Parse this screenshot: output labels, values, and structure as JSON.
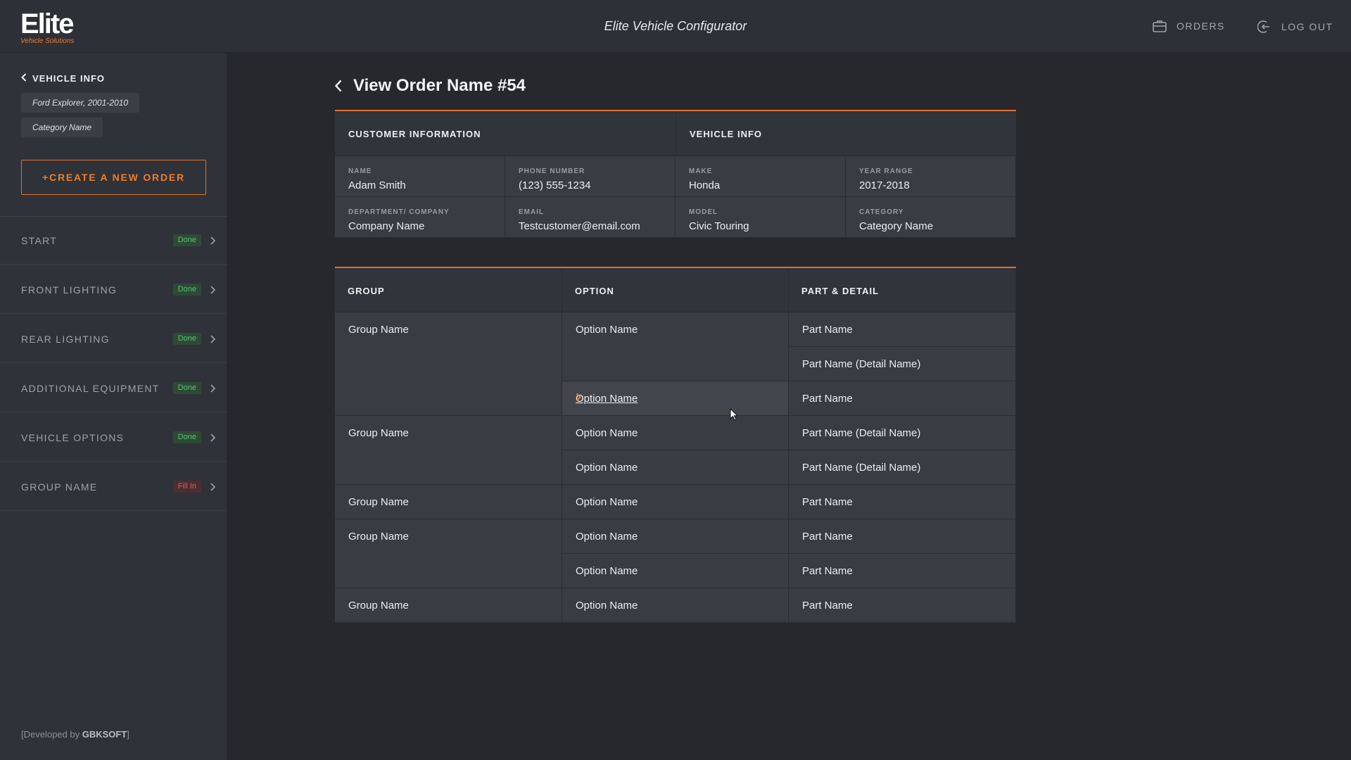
{
  "header": {
    "logo_main": "Elite",
    "logo_sub": "Vehicle Solutions",
    "title": "Elite Vehicle Configurator",
    "orders_label": "ORDERS",
    "orders_icon": "briefcase-icon",
    "logout_label": "LOG OUT",
    "logout_icon": "logout-icon"
  },
  "sidebar": {
    "back_label": "VEHICLE INFO",
    "vehicle_chip": "Ford Explorer, 2001-2010",
    "category_chip": "Category Name",
    "create_button": "+CREATE A NEW ORDER",
    "steps": [
      {
        "label": "START",
        "status": "Done"
      },
      {
        "label": "FRONT LIGHTING",
        "status": "Done"
      },
      {
        "label": "REAR LIGHTING",
        "status": "Done"
      },
      {
        "label": "ADDITIONAL EQUIPMENT",
        "status": "Done"
      },
      {
        "label": "VEHICLE OPTIONS",
        "status": "Done"
      },
      {
        "label": "GROUP NAME",
        "status": "Fill In"
      }
    ],
    "developed_prefix": "[Developed by ",
    "developer": "GBKSOFT",
    "developed_suffix": "]"
  },
  "main": {
    "page_title": "View Order Name #54",
    "customer": {
      "heading": "CUSTOMER INFORMATION",
      "name_label": "NAME",
      "name_value": "Adam Smith",
      "phone_label": "PHONE NUMBER",
      "phone_value": "(123) 555-1234",
      "dept_label": "DEPARTMENT/ COMPANY",
      "dept_value": "Company Name",
      "email_label": "EMAIL",
      "email_value": "Testcustomer@email.com"
    },
    "vehicle": {
      "heading": "VEHICLE INFO",
      "make_label": "MAKE",
      "make_value": "Honda",
      "year_label": "YEAR RANGE",
      "year_value": "2017-2018",
      "model_label": "MODEL",
      "model_value": "Civic Touring",
      "category_label": "CATEGORY",
      "category_value": "Category Name"
    },
    "table": {
      "headers": [
        "GROUP",
        "OPTION",
        "PART & DETAIL"
      ],
      "groups": [
        "Group Name",
        "Group Name",
        "Group Name",
        "Group Name",
        "Group Name"
      ],
      "options": [
        "Option Name",
        "Option Name",
        "Option Name",
        "Option Name",
        "Option Name",
        "Option Name",
        "Option Name",
        "Option Name"
      ],
      "parts": [
        "Part Name",
        "Part Name (Detail Name)",
        "Part Name",
        "Part Name (Detail Name)",
        "Part Name (Detail Name)",
        "Part Name",
        "Part Name",
        "Part Name",
        "Part Name"
      ]
    }
  },
  "colors": {
    "accent": "#f07c2c",
    "done": "#55c373",
    "fill_in": "#e35a5a"
  }
}
